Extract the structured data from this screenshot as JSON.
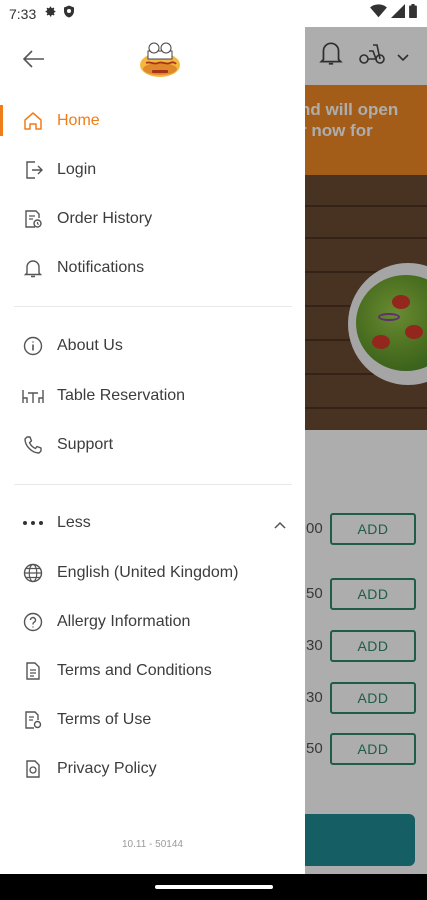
{
  "status_bar": {
    "time": "7:33",
    "left_icons": [
      "gear-icon",
      "shield-icon"
    ],
    "right_icons": [
      "wifi-icon",
      "signal-icon",
      "battery-icon"
    ]
  },
  "background_app": {
    "banner_text": "nd will open\nr now for",
    "prices": [
      "00",
      "50",
      "30",
      "30",
      "50"
    ],
    "add_label": "ADD",
    "accent_color": "#f08a24",
    "add_color": "#2e8a6a"
  },
  "drawer": {
    "back_icon": "arrow-left-icon",
    "logo_alt": "restaurant-logo",
    "accent_color": "#ef7d1a",
    "primary_items": [
      {
        "label": "Home",
        "icon": "home-icon",
        "active": true
      },
      {
        "label": "Login",
        "icon": "login-icon",
        "active": false
      },
      {
        "label": "Order History",
        "icon": "order-history-icon",
        "active": false
      },
      {
        "label": "Notifications",
        "icon": "bell-icon",
        "active": false
      }
    ],
    "secondary_items": [
      {
        "label": "About Us",
        "icon": "info-icon"
      },
      {
        "label": "Table Reservation",
        "icon": "table-icon"
      },
      {
        "label": "Support",
        "icon": "phone-icon"
      }
    ],
    "less_label": "Less",
    "tertiary_items": [
      {
        "label": "English (United Kingdom)",
        "icon": "globe-icon"
      },
      {
        "label": "Allergy Information",
        "icon": "question-icon"
      },
      {
        "label": "Terms and Conditions",
        "icon": "document-icon"
      },
      {
        "label": "Terms of Use",
        "icon": "document-settings-icon"
      },
      {
        "label": "Privacy Policy",
        "icon": "privacy-icon"
      }
    ],
    "version": "10.11 - 50144"
  }
}
